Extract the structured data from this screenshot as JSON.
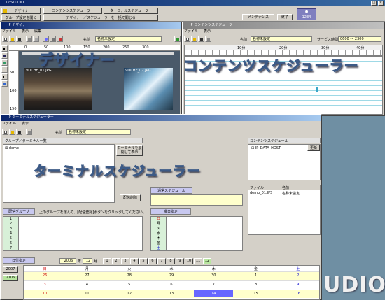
{
  "app": {
    "title": "IP STUDIO",
    "maximize_icon": "window-maximize-icon",
    "close_icon": "window-close-icon"
  },
  "toolbar": {
    "designer_label": "デザイナー",
    "content_scheduler_label": "コンテンツスケジューラー",
    "terminal_scheduler_label": "ターミナルスケジューラー",
    "group_setting_label": "グループ設定を開く",
    "designer_scheduler_label": "デザイナー／スケジューラーを一括で開じる",
    "maintenance_label": "メンテナンス",
    "exit_label": "終了",
    "info": "1234"
  },
  "designer": {
    "title": "IP デザイナー",
    "menu": [
      "ファイル",
      "表示",
      "編集"
    ],
    "name_label": "名前",
    "name_value": "名称未設定",
    "ruler": [
      "0",
      "50",
      "100",
      "150",
      "200",
      "250",
      "300"
    ],
    "vruler": [
      "50",
      "100",
      "150"
    ],
    "image1": "VOCHE_01.JPG",
    "image2": "VOCHE_02.JPG",
    "watermark": "デザイナー"
  },
  "content": {
    "title": "IP コンテンツスケジューラー",
    "menu": [
      "ファイル",
      "表示"
    ],
    "name_label": "名前",
    "name_value": "名称未設定",
    "service_label": "サービス時間",
    "service_value": "0600 〜 2300",
    "time_marks": [
      "10分",
      "20分",
      "30分",
      "40分"
    ],
    "watermark": "コンテンツスケジューラー"
  },
  "terminal": {
    "title": "IP ターミナルスケジューラー",
    "menu": [
      "ファイル",
      "表示"
    ],
    "name_label": "名前",
    "name_value": "名称未設定",
    "group_tree_header": "グループ／ターミナル一覧",
    "tree_root": "demo",
    "expand_btn": "ターミナルを展開して表示",
    "delete_btn": "配信削除",
    "content_header": "コンテンツスケジュール",
    "content_tree_item": "IP_DATA_HOST",
    "update_btn": "更新",
    "file_col": "ファイル",
    "name_col": "名前",
    "file_value": "demo_01.IPS",
    "name_value2": "名称未設定",
    "regular_header": "通常スケジュール",
    "group_header": "配信グループ",
    "group_msg": "上のグループを選んで、[配信登録]ボタンをクリックしてください。",
    "group_nums": [
      "1",
      "2",
      "3",
      "4",
      "5",
      "6",
      "7"
    ],
    "weekday_header": "曜日指定",
    "weekdays": [
      "日",
      "月",
      "火",
      "水",
      "木",
      "金",
      "土"
    ],
    "date_header": "日付指定",
    "year": "2006",
    "year_unit": "年",
    "month": "12",
    "month_unit": "月",
    "months": [
      "1",
      "2",
      "3",
      "4",
      "5",
      "6",
      "7",
      "8",
      "9",
      "10",
      "11",
      "12"
    ],
    "side_dates": [
      "2007",
      "2106"
    ],
    "cal_days": [
      "日",
      "月",
      "火",
      "水",
      "木",
      "金",
      "土"
    ],
    "cal_rows": [
      [
        "26",
        "27",
        "28",
        "29",
        "30",
        "1",
        "2"
      ],
      [
        "3",
        "4",
        "5",
        "6",
        "7",
        "8",
        "9"
      ],
      [
        "10",
        "11",
        "12",
        "13",
        "14",
        "15",
        "16"
      ]
    ],
    "watermark": "ターミナルスケジューラー"
  },
  "studio_watermark": "UDIO"
}
